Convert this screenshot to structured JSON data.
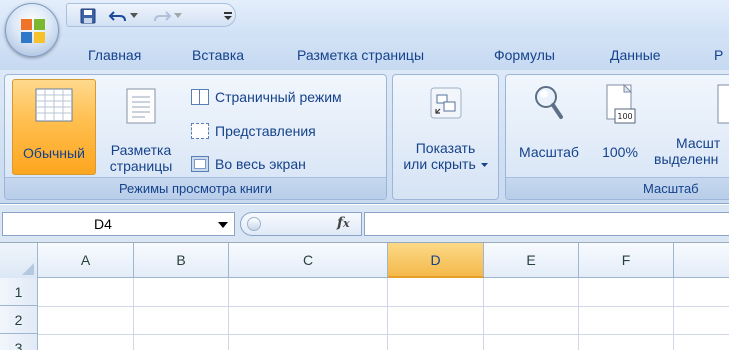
{
  "quick_access": {
    "icons": [
      "save-icon",
      "undo-icon",
      "redo-icon",
      "customize-icon"
    ]
  },
  "tabs": [
    "Главная",
    "Вставка",
    "Разметка страницы",
    "Формулы",
    "Данные",
    "Р"
  ],
  "ribbon": {
    "views_group": {
      "label": "Режимы просмотра книги",
      "normal": "Обычный",
      "page_layout_line1": "Разметка",
      "page_layout_line2": "страницы",
      "page_break": "Страничный режим",
      "custom_views": "Представления",
      "full_screen": "Во весь экран"
    },
    "show_group": {
      "line1": "Показать",
      "line2": "или скрыть"
    },
    "zoom_group": {
      "label": "Масштаб",
      "zoom": "Масштаб",
      "percent": "100%",
      "icon_text": "100",
      "selection_line1": "Масшт",
      "selection_line2": "выделенн"
    }
  },
  "formula_bar": {
    "name_box": "D4",
    "fx": "fx",
    "formula": ""
  },
  "sheet": {
    "columns": [
      "A",
      "B",
      "C",
      "D",
      "E",
      "F"
    ],
    "active_column": "D",
    "rows": [
      "1",
      "2",
      "3"
    ]
  },
  "colors": {
    "active_orange": "#fda61f",
    "ribbon_blue": "#15428b"
  }
}
